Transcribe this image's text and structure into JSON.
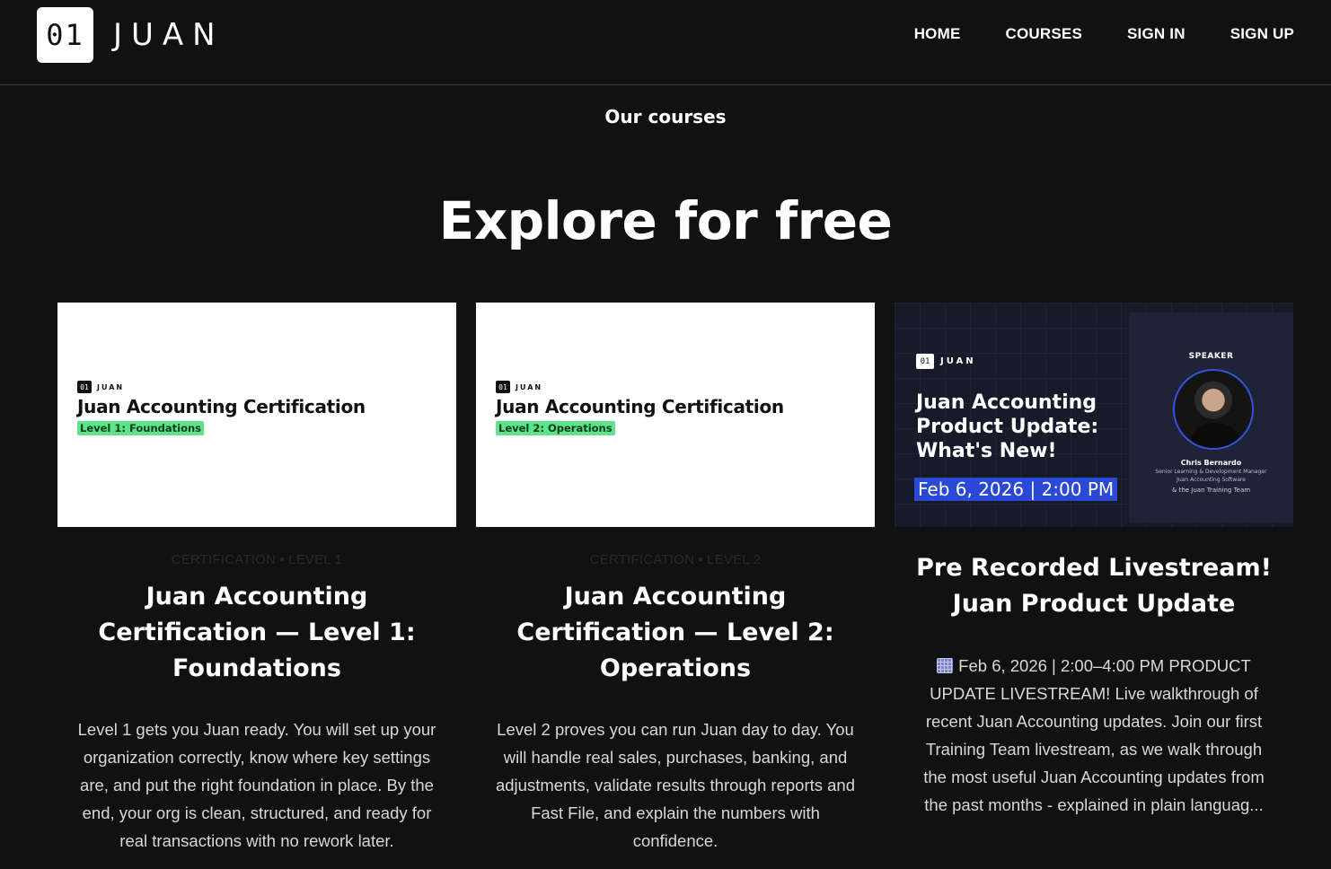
{
  "header": {
    "logo_mark": "01",
    "logo_word": "JUAN",
    "nav": [
      "HOME",
      "COURSES",
      "SIGN IN",
      "SIGN UP"
    ]
  },
  "section": {
    "eyebrow": "Our courses",
    "title": "Explore for free"
  },
  "cards": [
    {
      "thumb_brand_mark": "01",
      "thumb_brand_word": "JUAN",
      "thumb_title": "Juan Accounting Certification",
      "thumb_tag": "Level 1: Foundations",
      "meta": "CERTIFICATION • LEVEL 1",
      "title": "Juan Accounting Certification — Level 1: Foundations",
      "description": "Level 1 gets you Juan ready. You will set up your organization correctly, know where key settings are, and put the right foundation in place. By the end, your org is clean, structured, and ready for real transactions with no rework later."
    },
    {
      "thumb_brand_mark": "01",
      "thumb_brand_word": "JUAN",
      "thumb_title": "Juan Accounting Certification",
      "thumb_tag": "Level 2: Operations",
      "meta": "CERTIFICATION • LEVEL 2",
      "title": "Juan Accounting Certification — Level 2: Operations",
      "description": "Level 2 proves you can run Juan day to day. You will handle real sales, purchases, banking, and adjustments, validate results through reports and Fast File, and explain the numbers with confidence."
    },
    {
      "thumb_brand_mark": "01",
      "thumb_brand_word": "JUAN",
      "thumb_title": "Juan Accounting Product Update: What's New!",
      "thumb_date": "Feb 6, 2026 | 2:00 PM",
      "speaker_label": "SPEAKER",
      "speaker_name": "Chris Bernardo",
      "speaker_role_1": "Senior Learning & Development Manager",
      "speaker_role_2": "Juan Accounting Software",
      "speaker_team": "& the Juan Training Team",
      "title": "Pre Recorded Livestream! Juan Product Update",
      "description": "Feb 6, 2026 | 2:00–4:00 PM PRODUCT UPDATE LIVESTREAM! Live walkthrough of recent Juan Accounting updates. Join our first Training Team livestream, as we walk through the most useful Juan Accounting updates from the past months - explained in plain languag..."
    }
  ],
  "colors": {
    "background": "#111111",
    "tag_green": "#5ee28a",
    "date_highlight": "#2b49d6"
  },
  "icons": {
    "calendar": "calendar-icon"
  }
}
